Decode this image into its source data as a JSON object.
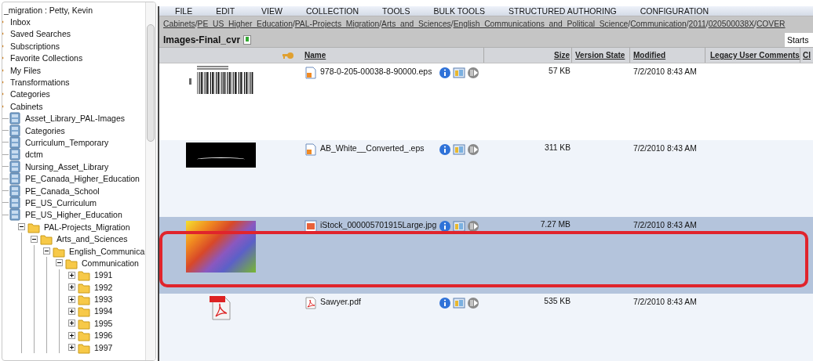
{
  "tree": {
    "user_line": "_migration : Petty, Kevin",
    "items": [
      {
        "label": "Inbox",
        "kind": "node"
      },
      {
        "label": "Saved Searches",
        "kind": "node"
      },
      {
        "label": "Subscriptions",
        "kind": "node"
      },
      {
        "label": "Favorite Collections",
        "kind": "node"
      },
      {
        "label": "My Files",
        "kind": "node"
      },
      {
        "label": "Transformations",
        "kind": "node"
      },
      {
        "label": "Categories",
        "kind": "node"
      },
      {
        "label": "Cabinets",
        "kind": "node",
        "children": [
          {
            "label": "Asset_Library_PAL-Images",
            "kind": "cabinet"
          },
          {
            "label": "Categories",
            "kind": "cabinet"
          },
          {
            "label": "Curriculum_Temporary",
            "kind": "cabinet"
          },
          {
            "label": "dctm",
            "kind": "cabinet"
          },
          {
            "label": "Nursing_Asset_Library",
            "kind": "cabinet"
          },
          {
            "label": "PE_Canada_Higher_Education",
            "kind": "cabinet"
          },
          {
            "label": "PE_Canada_School",
            "kind": "cabinet"
          },
          {
            "label": "PE_US_Curriculum",
            "kind": "cabinet"
          },
          {
            "label": "PE_US_Higher_Education",
            "kind": "cabinet",
            "children": [
              {
                "label": "PAL-Projects_Migration",
                "kind": "folder",
                "expanded": true,
                "children": [
                  {
                    "label": "Arts_and_Sciences",
                    "kind": "folder",
                    "expanded": true,
                    "children": [
                      {
                        "label": "English_Communica",
                        "kind": "folder",
                        "expanded": true,
                        "children": [
                          {
                            "label": "Communication",
                            "kind": "folder",
                            "expanded": true,
                            "children": [
                              {
                                "label": "1991",
                                "kind": "folder",
                                "expanded": false
                              },
                              {
                                "label": "1992",
                                "kind": "folder",
                                "expanded": false
                              },
                              {
                                "label": "1993",
                                "kind": "folder",
                                "expanded": false
                              },
                              {
                                "label": "1994",
                                "kind": "folder",
                                "expanded": false
                              },
                              {
                                "label": "1995",
                                "kind": "folder",
                                "expanded": false
                              },
                              {
                                "label": "1996",
                                "kind": "folder",
                                "expanded": false
                              },
                              {
                                "label": "1997",
                                "kind": "folder",
                                "expanded": false
                              }
                            ]
                          }
                        ]
                      }
                    ]
                  }
                ]
              }
            ]
          }
        ]
      }
    ]
  },
  "menu": [
    "FILE",
    "EDIT",
    "VIEW",
    "COLLECTION",
    "TOOLS",
    "BULK TOOLS",
    "STRUCTURED AUTHORING",
    "CONFIGURATION"
  ],
  "breadcrumb": [
    {
      "label": "Cabinets",
      "separator": "/"
    },
    {
      "label": "PE_US_Higher_Education",
      "separator": "/"
    },
    {
      "label": "PAL-Projects_Migration",
      "separator": "/"
    },
    {
      "label": "Arts_and_Sciences",
      "separator": "/"
    },
    {
      "label": "English_Communications_and_Political_Science",
      "separator": "/"
    },
    {
      "label": "Communication",
      "separator": "/"
    },
    {
      "label": "2011",
      "separator": "/"
    },
    {
      "label": "020500038X",
      "separator": "/"
    },
    {
      "label": "COVER"
    }
  ],
  "folder_title": "Images-Final_cvr",
  "filter": {
    "value": "Starts"
  },
  "table": {
    "columns": [
      "Name",
      "Size",
      "Version State",
      "Modified",
      "Legacy User Comments",
      "Cl"
    ],
    "rows": [
      {
        "thumbnail": {
          "kind": "barcode"
        },
        "file_icon": {
          "kind": "eps"
        },
        "name": "978-0-205-00038-8-90000.eps",
        "size": "57 KB",
        "modified": "7/2/2010 8:43 AM",
        "selected": false,
        "highlighted": false
      },
      {
        "thumbnail": {
          "kind": "logo"
        },
        "file_icon": {
          "kind": "eps"
        },
        "name": "AB_White__Converted_.eps",
        "size": "311 KB",
        "modified": "7/2/2010 8:43 AM",
        "selected": false,
        "highlighted": false
      },
      {
        "thumbnail": {
          "kind": "gradient"
        },
        "file_icon": {
          "kind": "jpg"
        },
        "name": "iStock_000005701915Large.jpg",
        "size": "7.27 MB",
        "modified": "7/2/2010 8:43 AM",
        "selected": true,
        "highlighted": true
      },
      {
        "thumbnail": {
          "kind": "pdf"
        },
        "file_icon": {
          "kind": "pdf"
        },
        "name": "Sawyer.pdf",
        "size": "535 KB",
        "modified": "7/2/2010 8:43 AM",
        "selected": false,
        "highlighted": false
      }
    ]
  }
}
